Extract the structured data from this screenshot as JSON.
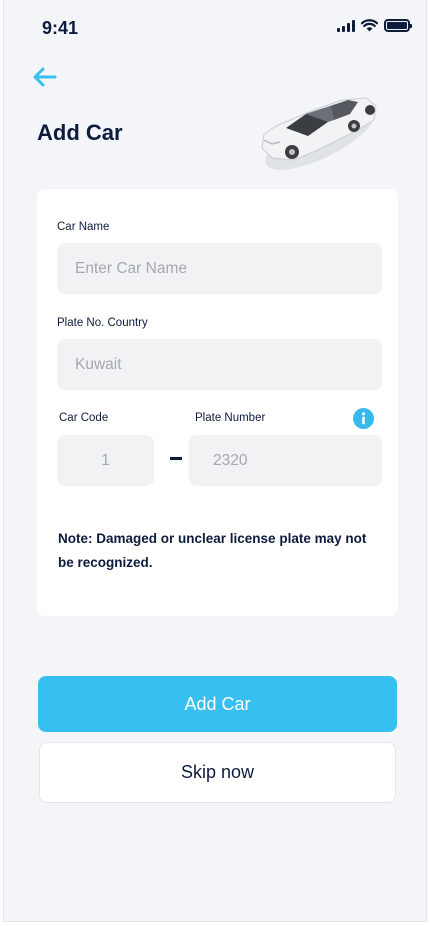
{
  "status_bar": {
    "time": "9:41"
  },
  "header": {
    "title": "Add Car"
  },
  "form": {
    "car_name": {
      "label": "Car Name",
      "placeholder": "Enter Car Name"
    },
    "plate_country": {
      "label": "Plate No. Country",
      "value": "Kuwait"
    },
    "car_code": {
      "label": "Car Code",
      "value": "1"
    },
    "plate_number": {
      "label": "Plate Number",
      "value": "2320"
    },
    "note": "Note: Damaged or unclear license plate may not be recognized."
  },
  "actions": {
    "primary_label": "Add Car",
    "secondary_label": "Skip now"
  },
  "colors": {
    "accent": "#36bfef",
    "text": "#0d1b3d",
    "background": "#f3f5f8"
  },
  "icons": [
    "signal-icon",
    "wifi-icon",
    "battery-icon",
    "back-arrow-icon",
    "car-icon",
    "info-icon"
  ]
}
